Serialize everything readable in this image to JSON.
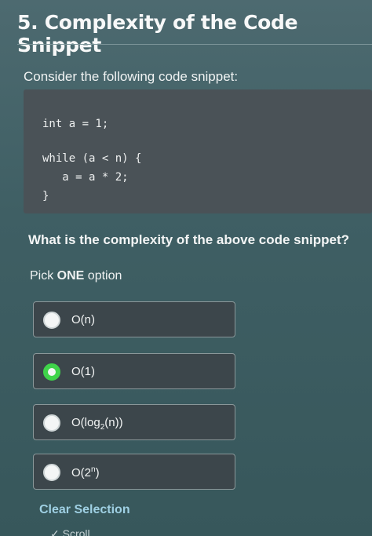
{
  "header": {
    "title": "5. Complexity of the Code Snippet"
  },
  "prompt": "Consider the following code snippet:",
  "code": {
    "lines": [
      "int a = 1;",
      "",
      "while (a < n) {",
      "   a = a * 2;",
      "}"
    ]
  },
  "question": "What is the complexity of the above code snippet?",
  "instructions": {
    "pre": "Pick ",
    "emph": "ONE",
    "post": " option"
  },
  "options": [
    {
      "label": "O(n)",
      "selected": false
    },
    {
      "label": "O(1)",
      "selected": true
    },
    {
      "label_base": "O(log",
      "label_sub": "2",
      "label_end": "(n))",
      "selected": false
    },
    {
      "label_base": "O(2",
      "label_sup": "n",
      "label_end": ")",
      "selected": false
    }
  ],
  "clear_selection": "Clear Selection",
  "partial_text": "✓ Scroll",
  "colors": {
    "selected_radio": "#3fd44a",
    "link": "#9fd0e3"
  }
}
